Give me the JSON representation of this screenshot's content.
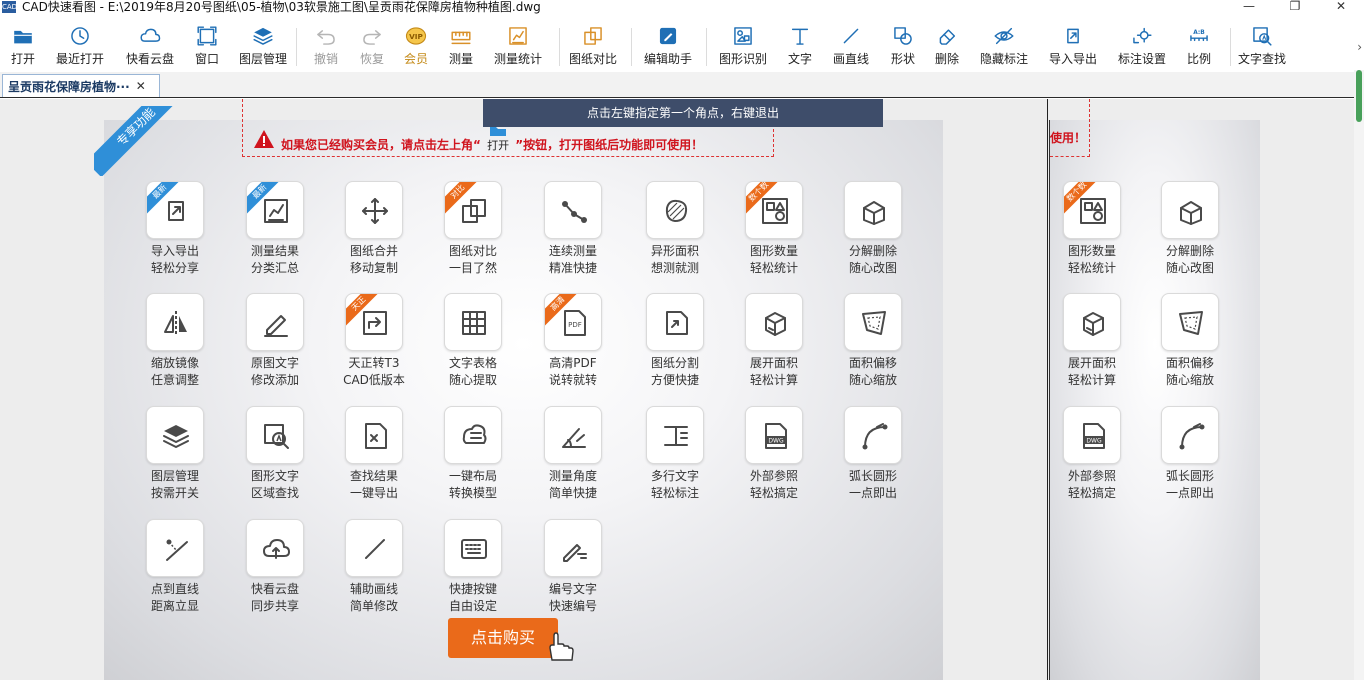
{
  "titlebar": {
    "app_icon": "CAD",
    "title": "CAD快速看图 - E:\\2019年8月20号图纸\\05-植物\\03软景施工图\\呈贡雨花保障房植物种植图.dwg",
    "minimize": "—",
    "restore": "❐",
    "close": "✕"
  },
  "toolbar": {
    "items": [
      {
        "label": "打开",
        "icon": "folder-open-icon"
      },
      {
        "label": "最近打开",
        "icon": "clock-icon"
      },
      {
        "label": "快看云盘",
        "icon": "cloud-icon"
      },
      {
        "label": "窗口",
        "icon": "window-icon"
      },
      {
        "label": "图层管理",
        "icon": "layers-icon"
      },
      {
        "label": "撤销",
        "icon": "undo-icon"
      },
      {
        "label": "恢复",
        "icon": "redo-icon"
      },
      {
        "label": "会员",
        "icon": "vip-icon"
      },
      {
        "label": "测量",
        "icon": "ruler-icon"
      },
      {
        "label": "测量统计",
        "icon": "measure-stats-icon"
      },
      {
        "label": "图纸对比",
        "icon": "compare-icon"
      },
      {
        "label": "编辑助手",
        "icon": "edit-assistant-icon"
      },
      {
        "label": "图形识别",
        "icon": "shape-recognition-icon"
      },
      {
        "label": "文字",
        "icon": "text-icon"
      },
      {
        "label": "画直线",
        "icon": "line-icon"
      },
      {
        "label": "形状",
        "icon": "shape-icon"
      },
      {
        "label": "删除",
        "icon": "eraser-icon"
      },
      {
        "label": "隐藏标注",
        "icon": "eye-hide-icon"
      },
      {
        "label": "导入导出",
        "icon": "import-export-icon"
      },
      {
        "label": "标注设置",
        "icon": "annotation-settings-icon"
      },
      {
        "label": "比例",
        "icon": "scale-icon"
      },
      {
        "label": "文字查找",
        "icon": "text-search-icon"
      }
    ],
    "more": "›"
  },
  "tabs": [
    {
      "label": "呈贡雨花保障房植物···",
      "close": "✕"
    }
  ],
  "hint": "点击左键指定第一个角点，右键退出",
  "ribbon": "专享功能",
  "notice": {
    "before": "如果您已经购买会员，请点击左上角“",
    "open_label": "打开",
    "after": "”按钮，打开图纸后功能即可使用！",
    "right_fragment": "使用！"
  },
  "features": [
    {
      "line1": "导入导出",
      "line2": "轻松分享",
      "badge": "最新",
      "badge_color": "blue",
      "icon": "import-export-icon"
    },
    {
      "line1": "测量结果",
      "line2": "分类汇总",
      "badge": "最新",
      "badge_color": "blue",
      "icon": "measure-stats-icon"
    },
    {
      "line1": "图纸合并",
      "line2": "移动复制",
      "badge": "",
      "badge_color": "",
      "icon": "move-icon"
    },
    {
      "line1": "图纸对比",
      "line2": "一目了然",
      "badge": "对比",
      "badge_color": "orange",
      "icon": "compare-icon"
    },
    {
      "line1": "连续测量",
      "line2": "精准快捷",
      "badge": "",
      "badge_color": "",
      "icon": "polyline-measure-icon"
    },
    {
      "line1": "异形面积",
      "line2": "想测就测",
      "badge": "",
      "badge_color": "",
      "icon": "irregular-area-icon"
    },
    {
      "line1": "图形数量",
      "line2": "轻松统计",
      "badge": "数个数",
      "badge_color": "orange",
      "icon": "shape-count-icon"
    },
    {
      "line1": "分解删除",
      "line2": "随心改图",
      "badge": "",
      "badge_color": "",
      "icon": "explode-icon"
    },
    {
      "line1": "缩放镜像",
      "line2": "任意调整",
      "badge": "",
      "badge_color": "",
      "icon": "mirror-icon"
    },
    {
      "line1": "原图文字",
      "line2": "修改添加",
      "badge": "",
      "badge_color": "",
      "icon": "pen-edit-icon"
    },
    {
      "line1": "天正转T3",
      "line2": "CAD低版本",
      "badge": "天正",
      "badge_color": "orange",
      "icon": "convert-icon"
    },
    {
      "line1": "文字表格",
      "line2": "随心提取",
      "badge": "",
      "badge_color": "",
      "icon": "table-extract-icon"
    },
    {
      "line1": "高清PDF",
      "line2": "说转就转",
      "badge": "高清",
      "badge_color": "orange",
      "icon": "pdf-icon"
    },
    {
      "line1": "图纸分割",
      "line2": "方便快捷",
      "badge": "",
      "badge_color": "",
      "icon": "split-icon"
    },
    {
      "line1": "展开面积",
      "line2": "轻松计算",
      "badge": "",
      "badge_color": "",
      "icon": "unfold-area-icon"
    },
    {
      "line1": "面积偏移",
      "line2": "随心缩放",
      "badge": "",
      "badge_color": "",
      "icon": "area-offset-icon"
    },
    {
      "line1": "图层管理",
      "line2": "按需开关",
      "badge": "",
      "badge_color": "",
      "icon": "layers-icon"
    },
    {
      "line1": "图形文字",
      "line2": "区域查找",
      "badge": "",
      "badge_color": "",
      "icon": "text-search-icon"
    },
    {
      "line1": "查找结果",
      "line2": "一键导出",
      "badge": "",
      "badge_color": "",
      "icon": "export-results-icon"
    },
    {
      "line1": "一键布局",
      "line2": "转换模型",
      "badge": "",
      "badge_color": "",
      "icon": "layout-convert-icon"
    },
    {
      "line1": "测量角度",
      "line2": "简单快捷",
      "badge": "",
      "badge_color": "",
      "icon": "angle-icon"
    },
    {
      "line1": "多行文字",
      "line2": "轻松标注",
      "badge": "",
      "badge_color": "",
      "icon": "multiline-text-icon"
    },
    {
      "line1": "外部参照",
      "line2": "轻松搞定",
      "badge": "",
      "badge_color": "",
      "icon": "dwg-reference-icon"
    },
    {
      "line1": "弧长圆形",
      "line2": "一点即出",
      "badge": "",
      "badge_color": "",
      "icon": "arc-icon"
    },
    {
      "line1": "点到直线",
      "line2": "距离立显",
      "badge": "",
      "badge_color": "",
      "icon": "point-line-distance-icon"
    },
    {
      "line1": "快看云盘",
      "line2": "同步共享",
      "badge": "",
      "badge_color": "",
      "icon": "cloud-sync-icon"
    },
    {
      "line1": "辅助画线",
      "line2": "简单修改",
      "badge": "",
      "badge_color": "",
      "icon": "line-icon"
    },
    {
      "line1": "快捷按键",
      "line2": "自由设定",
      "badge": "",
      "badge_color": "",
      "icon": "keyboard-icon"
    },
    {
      "line1": "编号文字",
      "line2": "快速编号",
      "badge": "",
      "badge_color": "",
      "icon": "numbering-icon"
    }
  ],
  "right_features": [
    {
      "line1": "图形数量",
      "line2": "轻松统计",
      "badge": "数个数",
      "badge_color": "orange",
      "icon": "shape-count-icon"
    },
    {
      "line1": "分解删除",
      "line2": "随心改图",
      "badge": "",
      "badge_color": "",
      "icon": "explode-icon"
    },
    {
      "line1": "展开面积",
      "line2": "轻松计算",
      "badge": "",
      "badge_color": "",
      "icon": "unfold-area-icon"
    },
    {
      "line1": "面积偏移",
      "line2": "随心缩放",
      "badge": "",
      "badge_color": "",
      "icon": "area-offset-icon"
    },
    {
      "line1": "外部参照",
      "line2": "轻松搞定",
      "badge": "",
      "badge_color": "",
      "icon": "dwg-reference-icon"
    },
    {
      "line1": "弧长圆形",
      "line2": "一点即出",
      "badge": "",
      "badge_color": "",
      "icon": "arc-icon"
    }
  ],
  "buy_button": "点击购买",
  "colors": {
    "toolbar_icon": "#1f6fb5",
    "feature_icon": "#4a4a4a",
    "accent_orange": "#ea6a1a",
    "ribbon_blue": "#2f8fd8",
    "warning_red": "#d0141e",
    "hint_bg": "#3e4d6a"
  }
}
